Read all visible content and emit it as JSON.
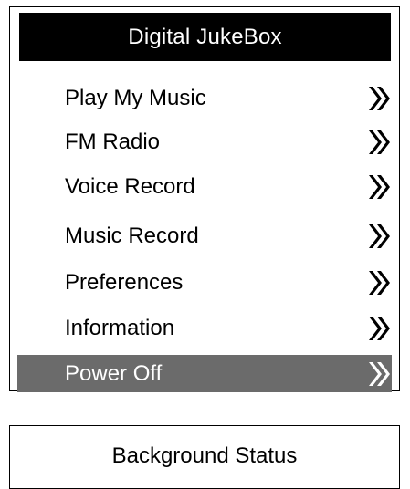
{
  "app": {
    "title": "Digital JukeBox"
  },
  "menu": {
    "items": [
      {
        "label": "Play My Music",
        "icon": "double-chevron-right-icon",
        "selected": false
      },
      {
        "label": "FM Radio",
        "icon": "double-chevron-right-icon",
        "selected": false
      },
      {
        "label": "Voice Record",
        "icon": "double-chevron-right-icon",
        "selected": false
      },
      {
        "label": "Music Record",
        "icon": "double-chevron-right-icon",
        "selected": false
      },
      {
        "label": "Preferences",
        "icon": "double-chevron-right-icon",
        "selected": false
      },
      {
        "label": "Information",
        "icon": "double-chevron-right-icon",
        "selected": false
      },
      {
        "label": "Power Off",
        "icon": "double-chevron-right-icon",
        "selected": true
      }
    ]
  },
  "status": {
    "title": "Background Status"
  },
  "colors": {
    "title_bar_bg": "#000000",
    "title_bar_text": "#ffffff",
    "selected_bg": "#6b6b6b",
    "selected_text": "#ffffff",
    "text": "#000000"
  }
}
